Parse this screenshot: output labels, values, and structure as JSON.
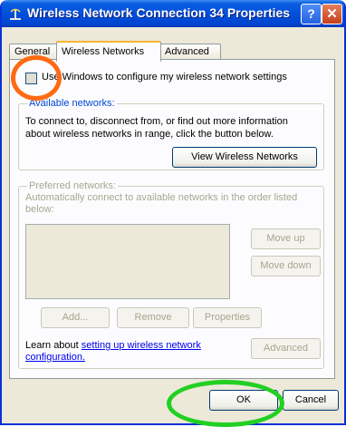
{
  "window": {
    "title": "Wireless Network Connection 34 Properties",
    "help_button": "?",
    "close_button": "✕"
  },
  "tabs": [
    {
      "label": "General"
    },
    {
      "label": "Wireless Networks"
    },
    {
      "label": "Advanced"
    }
  ],
  "wireless": {
    "use_windows_label": "Use Windows to configure my wireless network settings",
    "use_windows_checked": false,
    "available": {
      "legend": "Available networks:",
      "description_line1": "To connect to, disconnect from, or find out more information",
      "description_line2": "about wireless networks in range, click the button below.",
      "view_button": "View Wireless Networks"
    },
    "preferred": {
      "legend": "Preferred networks:",
      "description_line1": "Automatically connect to available networks in the order listed",
      "description_line2": "below:",
      "move_up": "Move up",
      "move_down": "Move down",
      "add": "Add...",
      "remove": "Remove",
      "properties": "Properties"
    },
    "learn_prefix": "Learn about ",
    "learn_link_line1": "setting up wireless network",
    "learn_link_line2": "configuration.",
    "advanced_button": "Advanced"
  },
  "footer": {
    "ok": "OK",
    "cancel": "Cancel"
  },
  "annotations": {
    "highlight_color_checkbox": "#ff6a13",
    "highlight_color_ok": "#22d022"
  }
}
